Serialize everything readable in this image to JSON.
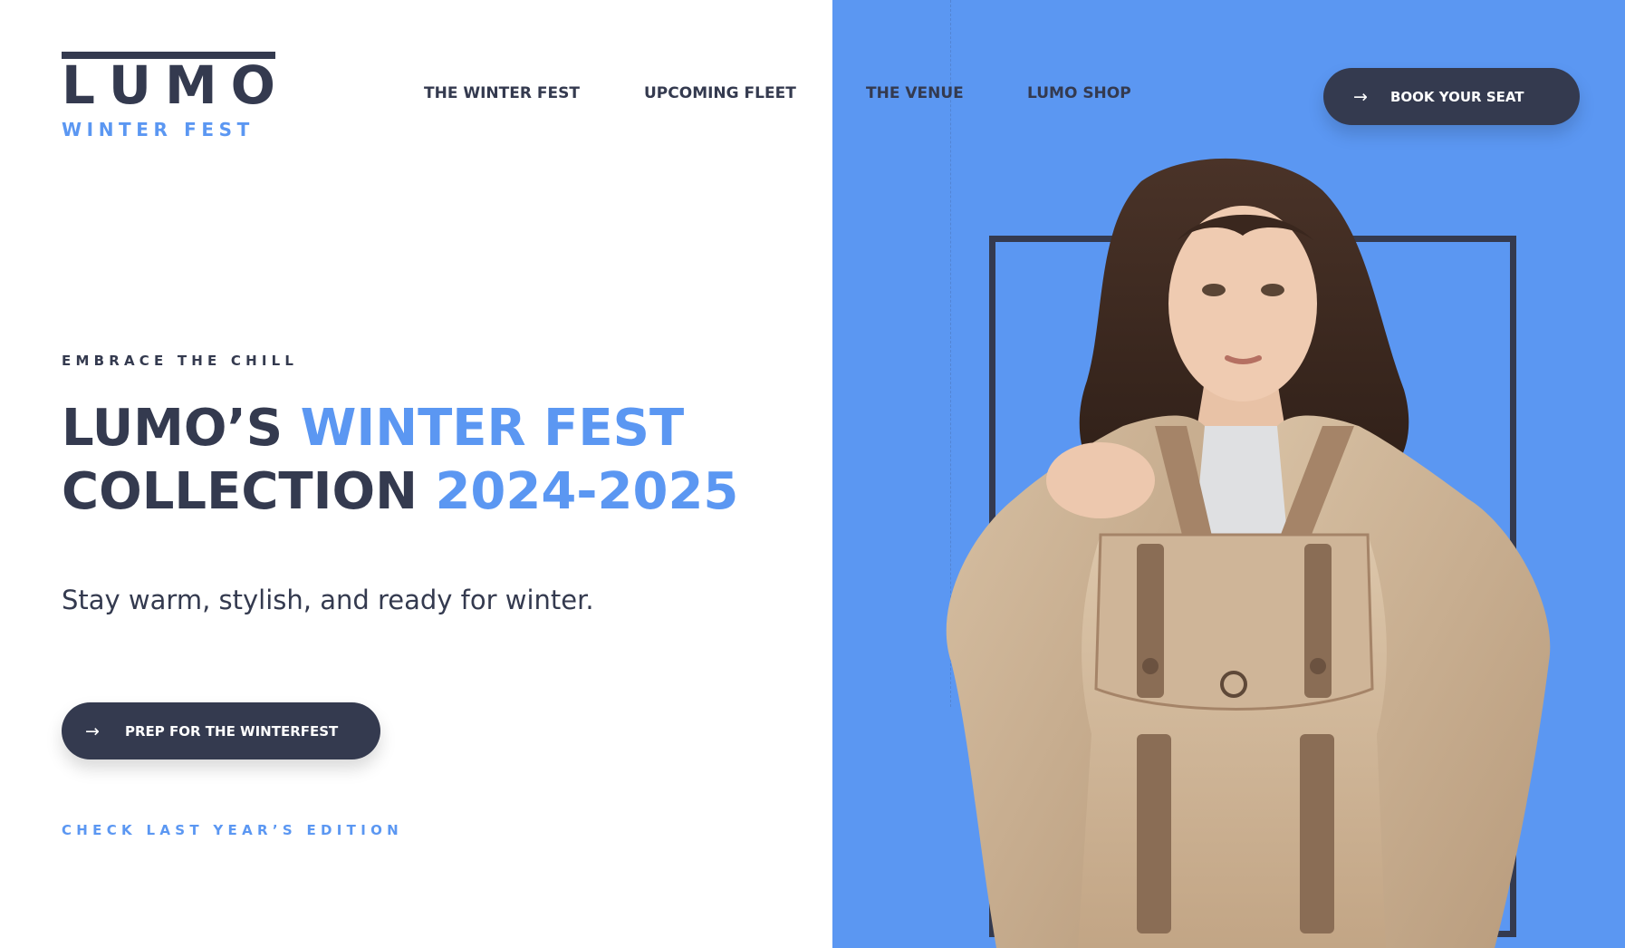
{
  "logo": {
    "word": [
      "L",
      "U",
      "M",
      "O"
    ],
    "subtitle": "WINTER FEST"
  },
  "nav": {
    "items": [
      {
        "label": "THE WINTER FEST"
      },
      {
        "label": "UPCOMING FLEET"
      },
      {
        "label": "THE VENUE"
      },
      {
        "label": "LUMO SHOP"
      }
    ],
    "cta_label": "BOOK YOUR SEAT",
    "cta_icon": "arrow-right-icon"
  },
  "hero": {
    "eyebrow": "EMBRACE THE CHILL",
    "headline_line1_a": "LUMO’S ",
    "headline_line1_b": "WINTER FEST",
    "headline_line2_a": "COLLECTION ",
    "headline_line2_b": "2024-2025",
    "tagline": "Stay warm, stylish, and ready for winter.",
    "cta_label": "PREP FOR THE WINTERFEST",
    "cta_icon": "arrow-right-icon",
    "secondary_link": "CHECK LAST YEAR’S EDITION"
  },
  "colors": {
    "navy": "#343a4f",
    "accent_blue": "#5b97f2",
    "background": "#ffffff"
  }
}
